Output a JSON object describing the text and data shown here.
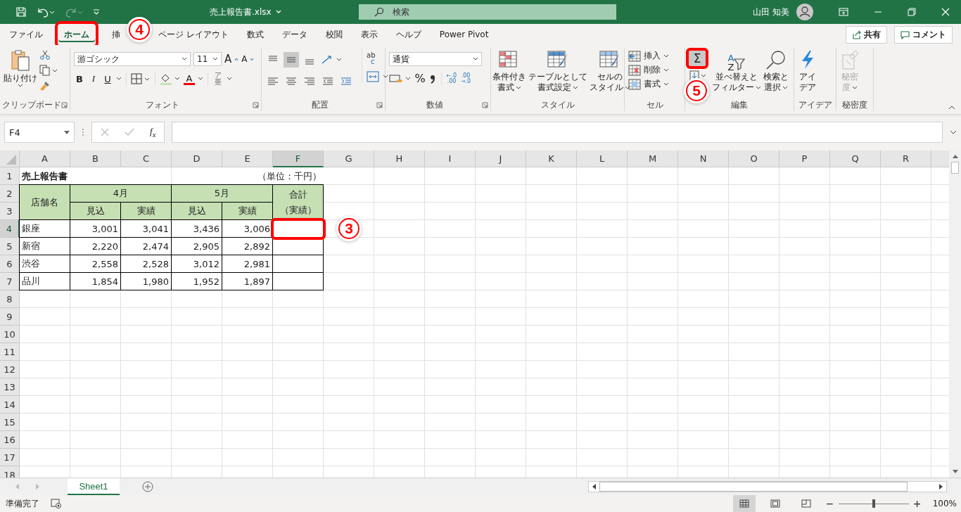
{
  "title_bar": {
    "file_name": "売上報告書.xlsx",
    "search_placeholder": "検索",
    "user_name": "山田 知美",
    "redo_disabled": true
  },
  "tabs": [
    {
      "label": "ファイル",
      "selected": false
    },
    {
      "label": "ホーム",
      "selected": true,
      "highlighted": true,
      "callout": "4"
    },
    {
      "label": "挿",
      "selected": false
    },
    {
      "label": "ページ レイアウト",
      "selected": false
    },
    {
      "label": "数式",
      "selected": false
    },
    {
      "label": "データ",
      "selected": false
    },
    {
      "label": "校閲",
      "selected": false
    },
    {
      "label": "表示",
      "selected": false
    },
    {
      "label": "ヘルプ",
      "selected": false
    },
    {
      "label": "Power Pivot",
      "selected": false
    }
  ],
  "header_buttons": {
    "share": "共有",
    "comment": "コメント"
  },
  "ribbon": [
    {
      "kind": "clipboard",
      "label": "クリップボード",
      "paste": "貼り付け"
    },
    {
      "kind": "font",
      "label": "フォント",
      "font_name": "游ゴシック",
      "font_size": "11",
      "grow": "A",
      "shrink": "A",
      "bold": "B",
      "italic": "I",
      "underline": "U",
      "font_color": "A",
      "phonetic": [
        "ア",
        "亜"
      ]
    },
    {
      "kind": "alignment",
      "label": "配置",
      "wrap": [
        "ab",
        "c"
      ]
    },
    {
      "kind": "number",
      "label": "数値",
      "format": "通貨",
      "percent": "%",
      "decimals": [
        {
          "lines": [
            "←.0",
            ".00"
          ]
        },
        {
          "lines": [
            ".00",
            "→.0"
          ]
        }
      ]
    },
    {
      "kind": "styles",
      "label": "スタイル",
      "buttons": [
        {
          "lines": [
            "条件付き",
            "書式"
          ]
        },
        {
          "lines": [
            "テーブルとして",
            "書式設定"
          ]
        },
        {
          "lines": [
            "セルの",
            "スタイル"
          ]
        }
      ]
    },
    {
      "kind": "cells",
      "label": "セル",
      "buttons": [
        "挿入",
        "削除",
        "書式"
      ]
    },
    {
      "kind": "editing",
      "label": "編集",
      "autosum": {
        "symbol": "Σ",
        "highlighted": true,
        "callout": "5"
      },
      "sort_icon": [
        "A",
        "Z"
      ],
      "buttons": [
        {
          "lines": [
            "並べ替えと",
            "フィルター"
          ]
        },
        {
          "lines": [
            "検索と",
            "選択"
          ]
        }
      ]
    },
    {
      "kind": "ideas",
      "label": "アイデア",
      "buttons": [
        {
          "lines": [
            "アイ",
            "デア"
          ],
          "disabled": false
        }
      ]
    },
    {
      "kind": "sensitivity",
      "label": "秘密度",
      "buttons": [
        {
          "lines": [
            "秘密",
            "度"
          ],
          "disabled": true
        }
      ]
    }
  ],
  "formula_bar": {
    "name_box": "F4",
    "function_button": "f$_{x}$"
  },
  "sheet": {
    "columns": [
      {
        "label": "A",
        "selected": false
      },
      {
        "label": "B",
        "selected": false
      },
      {
        "label": "C",
        "selected": false
      },
      {
        "label": "D",
        "selected": false
      },
      {
        "label": "E",
        "selected": false
      },
      {
        "label": "F",
        "selected": true
      },
      {
        "label": "G",
        "selected": false
      },
      {
        "label": "H",
        "selected": false
      },
      {
        "label": "I",
        "selected": false
      },
      {
        "label": "J",
        "selected": false
      },
      {
        "label": "K",
        "selected": false
      },
      {
        "label": "L",
        "selected": false
      },
      {
        "label": "M",
        "selected": false
      },
      {
        "label": "N",
        "selected": false
      },
      {
        "label": "O",
        "selected": false
      },
      {
        "label": "P",
        "selected": false
      },
      {
        "label": "Q",
        "selected": false
      },
      {
        "label": "R",
        "selected": false
      }
    ],
    "rows": [
      {
        "label": "1",
        "selected": false
      },
      {
        "label": "2",
        "selected": false
      },
      {
        "label": "3",
        "selected": false
      },
      {
        "label": "4",
        "selected": true
      },
      {
        "label": "5",
        "selected": false
      },
      {
        "label": "6",
        "selected": false
      },
      {
        "label": "7",
        "selected": false
      },
      {
        "label": "8",
        "selected": false
      },
      {
        "label": "9",
        "selected": false
      },
      {
        "label": "10",
        "selected": false
      },
      {
        "label": "11",
        "selected": false
      },
      {
        "label": "12",
        "selected": false
      },
      {
        "label": "13",
        "selected": false
      },
      {
        "label": "14",
        "selected": false
      },
      {
        "label": "15",
        "selected": false
      },
      {
        "label": "16",
        "selected": false
      },
      {
        "label": "17",
        "selected": false
      },
      {
        "label": "18",
        "selected": false
      }
    ],
    "report": {
      "title": "売上報告書",
      "unit": "（単位：千円）",
      "store_header": "店舗名",
      "months": [
        {
          "label": "4月",
          "columns": [
            "見込",
            "実績"
          ]
        },
        {
          "label": "5月",
          "columns": [
            "見込",
            "実績"
          ]
        }
      ],
      "total_header": [
        "合計",
        "（実績）"
      ],
      "stores": [
        {
          "name": "銀座",
          "values": [
            "3,001",
            "3,041",
            "3,436",
            "3,006"
          ],
          "total": {
            "highlighted": true,
            "callout": "3"
          }
        },
        {
          "name": "新宿",
          "values": [
            "2,220",
            "2,474",
            "2,905",
            "2,892"
          ],
          "total": {
            "highlighted": false
          }
        },
        {
          "name": "渋谷",
          "values": [
            "2,558",
            "2,528",
            "3,012",
            "2,981"
          ],
          "total": {
            "highlighted": false
          }
        },
        {
          "name": "品川",
          "values": [
            "1,854",
            "1,980",
            "1,952",
            "1,897"
          ],
          "total": {
            "highlighted": false
          }
        }
      ]
    }
  },
  "sheet_tabs": [
    {
      "label": "Sheet1",
      "selected": true
    }
  ],
  "status_bar": {
    "status": "準備完了",
    "views": [
      {
        "kind": "normal",
        "selected": true
      },
      {
        "kind": "page_layout",
        "selected": false
      },
      {
        "kind": "page_break",
        "selected": false
      }
    ],
    "zoom_out": "−",
    "zoom_in": "+",
    "zoom": {
      "level": 0.5
    },
    "zoom_label": "100%"
  }
}
